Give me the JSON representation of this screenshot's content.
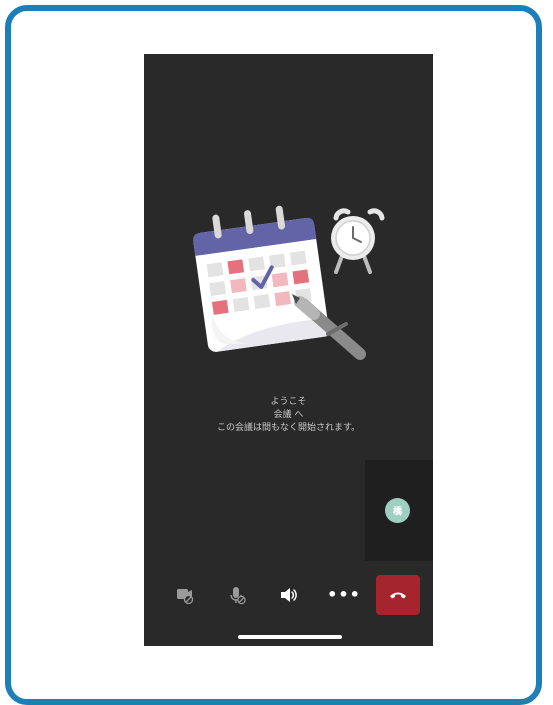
{
  "welcome": {
    "line1": "ようこそ",
    "line2": "会議 へ",
    "line3": "この会議は間もなく開始されます。"
  },
  "participant": {
    "initial": "橋",
    "avatar_color": "#9fcfc0"
  },
  "toolbar": {
    "camera_icon": "camera-off-icon",
    "mic_icon": "mic-off-icon",
    "speaker_icon": "speaker-icon",
    "more_label": "•••",
    "end_call_icon": "hang-up-icon",
    "end_call_color": "#a4262c"
  },
  "colors": {
    "frame_border": "#1e7fb8",
    "background": "#292929",
    "calendar_header": "#6264a7"
  }
}
